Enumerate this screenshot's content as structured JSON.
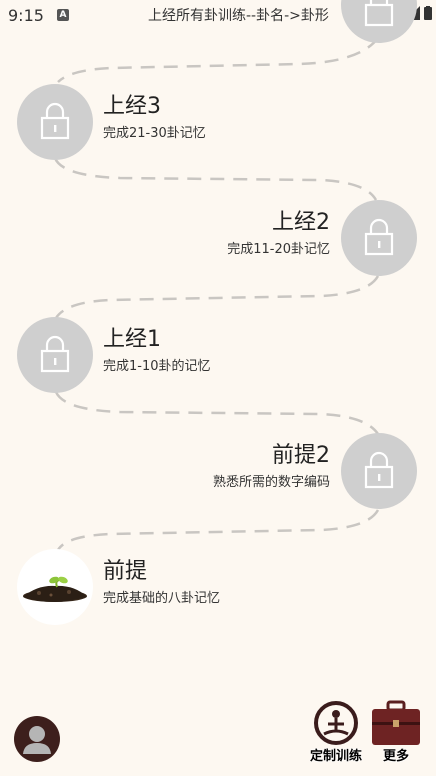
{
  "status_bar": {
    "time": "9:15",
    "title": "上经所有卦训练--卦名->卦形"
  },
  "levels": [
    {
      "title": "上经3",
      "desc": "完成21-30卦记忆",
      "locked": true
    },
    {
      "title": "上经2",
      "desc": "完成11-20卦记忆",
      "locked": true
    },
    {
      "title": "上经1",
      "desc": "完成1-10卦的记忆",
      "locked": true
    },
    {
      "title": "前提2",
      "desc": "熟悉所需的数字编码",
      "locked": true
    },
    {
      "title": "前提",
      "desc": "完成基础的八卦记忆",
      "locked": false
    }
  ],
  "bottom": {
    "custom_training_label": "定制训练",
    "more_label": "更多"
  },
  "colors": {
    "background": "#fdf8f1",
    "locked_circle": "#cfcfcf",
    "path": "#c9c6c2"
  }
}
